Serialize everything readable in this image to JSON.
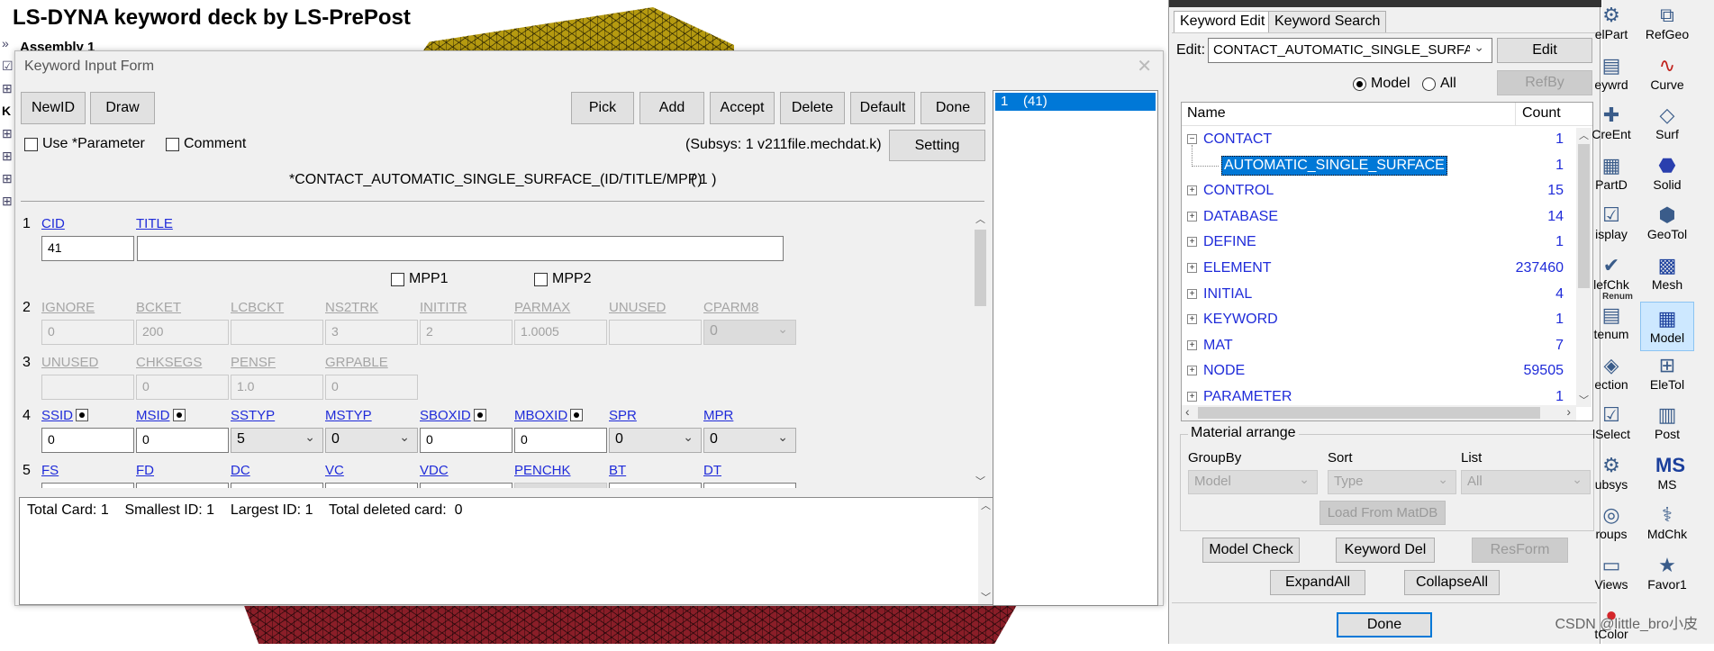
{
  "header": {
    "title": "LS-DYNA keyword deck by LS-PrePost",
    "behind_text": "Assembly 1",
    "behind_k": "K"
  },
  "kif": {
    "title": "Keyword Input Form",
    "buttons": {
      "newid": "NewID",
      "draw": "Draw",
      "pick": "Pick",
      "add": "Add",
      "accept": "Accept",
      "delete": "Delete",
      "default": "Default",
      "done": "Done",
      "setting": "Setting"
    },
    "use_parameter": "Use *Parameter",
    "comment": "Comment",
    "subsys": "(Subsys: 1 v211file.mechdat.k)",
    "keyword_title": "*CONTACT_AUTOMATIC_SINGLE_SURFACE_(ID/TITLE/MPP)",
    "keyword_count": "( 1 )",
    "mpp1": "MPP1",
    "mpp2": "MPP2",
    "rows": {
      "r1": {
        "no": "1",
        "cid": "CID",
        "title": "TITLE",
        "cid_val": "41",
        "title_val": ""
      },
      "r2": {
        "no": "2",
        "labels": [
          "IGNORE",
          "BCKET",
          "LCBCKT",
          "NS2TRK",
          "INITITR",
          "PARMAX",
          "UNUSED",
          "CPARM8"
        ],
        "values": [
          "0",
          "200",
          "",
          "3",
          "2",
          "1.0005",
          "",
          "0"
        ]
      },
      "r3": {
        "no": "3",
        "labels": [
          "UNUSED",
          "CHKSEGS",
          "PENSF",
          "GRPABLE"
        ],
        "values": [
          "",
          "0",
          "1.0",
          "0"
        ]
      },
      "r4": {
        "no": "4",
        "labels": [
          "SSID",
          "MSID",
          "SSTYP",
          "MSTYP",
          "SBOXID",
          "MBOXID",
          "SPR",
          "MPR"
        ],
        "values": [
          "0",
          "0",
          "5",
          "0",
          "0",
          "0",
          "0",
          "0"
        ]
      },
      "r5": {
        "no": "5",
        "labels": [
          "FS",
          "FD",
          "DC",
          "VC",
          "VDC",
          "PENCHK",
          "BT",
          "DT"
        ]
      }
    },
    "message": "Total Card: 1    Smallest ID: 1    Largest ID: 1    Total deleted card:  0",
    "list_item": "1    (41)"
  },
  "right_panel": {
    "tabs": [
      "Keyword Edit",
      "Keyword Search"
    ],
    "edit_label": "Edit:",
    "edit_value": "CONTACT_AUTOMATIC_SINGLE_SURFAC",
    "edit_button": "Edit",
    "radio_model": "Model",
    "radio_all": "All",
    "refby": "RefBy",
    "tree_headers": {
      "name": "Name",
      "count": "Count"
    },
    "tree": [
      {
        "name": "CONTACT",
        "count": "1",
        "exp": "−"
      },
      {
        "name": "AUTOMATIC_SINGLE_SURFACE",
        "count": "1",
        "child": true
      },
      {
        "name": "CONTROL",
        "count": "15",
        "exp": "+"
      },
      {
        "name": "DATABASE",
        "count": "14",
        "exp": "+"
      },
      {
        "name": "DEFINE",
        "count": "1",
        "exp": "+"
      },
      {
        "name": "ELEMENT",
        "count": "237460",
        "exp": "+"
      },
      {
        "name": "INITIAL",
        "count": "4",
        "exp": "+"
      },
      {
        "name": "KEYWORD",
        "count": "1",
        "exp": "+"
      },
      {
        "name": "MAT",
        "count": "7",
        "exp": "+"
      },
      {
        "name": "NODE",
        "count": "59505",
        "exp": "+"
      },
      {
        "name": "PARAMETER",
        "count": "1",
        "exp": "+"
      }
    ],
    "material_arrange": "Material arrange",
    "groupby_label": "GroupBy",
    "sort_label": "Sort",
    "list_label": "List",
    "groupby_val": "Model",
    "sort_val": "Type",
    "list_val": "All",
    "load_matdb": "Load From MatDB",
    "model_check": "Model Check",
    "keyword_del": "Keyword Del",
    "resform": "ResForm",
    "expand_all": "ExpandAll",
    "collapse_all": "CollapseAll",
    "done": "Done"
  },
  "toolbar": {
    "items": [
      {
        "label": "elPart",
        "icon": "part-icon"
      },
      {
        "label": "RefGeo",
        "icon": "refgeo-icon"
      },
      {
        "label": "eywrd",
        "icon": "keyword-icon"
      },
      {
        "label": "Curve",
        "icon": "curve-icon"
      },
      {
        "label": "CreEnt",
        "icon": "create-entity-icon"
      },
      {
        "label": "Surf",
        "icon": "surface-icon"
      },
      {
        "label": "PartD",
        "icon": "part-data-icon"
      },
      {
        "label": "Solid",
        "icon": "solid-icon"
      },
      {
        "label": "isplay",
        "icon": "display-icon"
      },
      {
        "label": "GeoTol",
        "icon": "geotol-icon"
      },
      {
        "label": "lefChk",
        "icon": "element-check-icon"
      },
      {
        "label": "Mesh",
        "icon": "mesh-icon"
      },
      {
        "label": "tenum",
        "icon": "renumber-icon"
      },
      {
        "label": "Model",
        "icon": "model-icon"
      },
      {
        "label": "ection",
        "icon": "section-icon"
      },
      {
        "label": "EleTol",
        "icon": "eletol-icon"
      },
      {
        "label": "lSelect",
        "icon": "select-icon"
      },
      {
        "label": "Post",
        "icon": "post-icon"
      },
      {
        "label": "ubsys",
        "icon": "subsys-icon"
      },
      {
        "label": "MS",
        "icon": "ms-icon"
      },
      {
        "label": "roups",
        "icon": "groups-icon"
      },
      {
        "label": "MdChk",
        "icon": "model-check-icon"
      },
      {
        "label": "Views",
        "icon": "views-icon"
      },
      {
        "label": "Favor1",
        "icon": "favorite-icon"
      },
      {
        "label": "tColor",
        "icon": "color-icon"
      }
    ],
    "renum_small": "Renum"
  },
  "watermark": "CSDN @little_bro小皮",
  "colors": {
    "link": "#1f2bd9",
    "selection": "#0078d7",
    "mesh_yellow": "#b59a10",
    "mesh_red": "#8a1e28"
  }
}
